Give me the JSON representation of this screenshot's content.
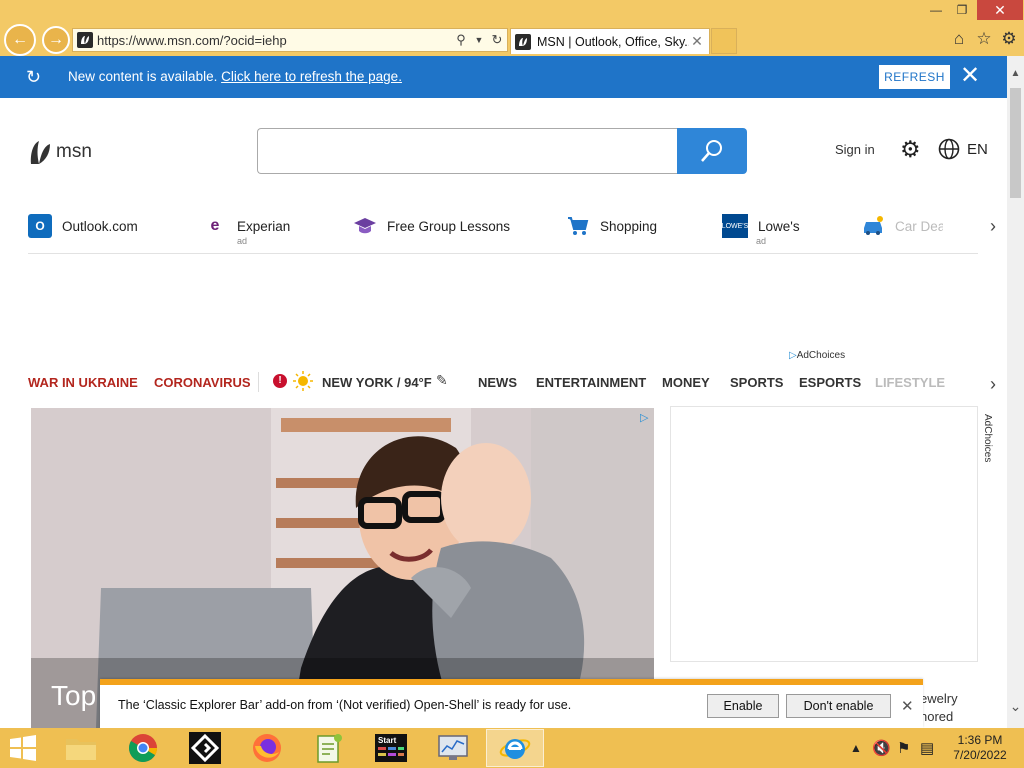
{
  "browser": {
    "url": "https://www.msn.com/?ocid=iehp",
    "tab_title": "MSN | Outlook, Office, Sky...",
    "window_controls": {
      "minimize": "—",
      "maximize": "❐",
      "close": "✕"
    }
  },
  "notification": {
    "message": "New content is available. ",
    "link_text": "Click here to refresh the page.",
    "refresh_label": "REFRESH"
  },
  "header": {
    "logo_text": "msn",
    "sign_in": "Sign in",
    "language": "EN"
  },
  "quicklinks": [
    {
      "label": "Outlook.com",
      "ad": "",
      "icon": "outlook-icon",
      "color": "#0f6cbd"
    },
    {
      "label": "Experian",
      "ad": "ad",
      "icon": "experian-icon",
      "color": "#6d2077"
    },
    {
      "label": "Free Group Lessons",
      "ad": "",
      "icon": "graduation-cap-icon",
      "color": "#6b3fa0"
    },
    {
      "label": "Shopping",
      "ad": "",
      "icon": "shopping-cart-icon",
      "color": "#1f74c8"
    },
    {
      "label": "Lowe's",
      "ad": "ad",
      "icon": "lowes-icon",
      "color": "#004990"
    },
    {
      "label": "Car Deals",
      "ad": "",
      "icon": "car-icon",
      "color": "#2f86d8"
    }
  ],
  "adchoices": "AdChoices",
  "topnav": {
    "war": "WAR IN UKRAINE",
    "corona": "CORONAVIRUS",
    "weather": "NEW YORK / 94°F",
    "news": "NEWS",
    "entertainment": "ENTERTAINMENT",
    "money": "MONEY",
    "sports": "SPORTS",
    "esports": "ESPORTS",
    "lifestyle": "LIFESTYLE"
  },
  "hero": {
    "title": "Top"
  },
  "card_peek": {
    "line1": "ewelry",
    "line2": "nored"
  },
  "addon_bar": {
    "message": "The ‘Classic Explorer Bar’ add-on from ‘(Not verified) Open-Shell’ is ready for use.",
    "enable": "Enable",
    "dont_enable": "Don't enable"
  },
  "taskbar": {
    "apps": [
      "file-explorer",
      "chrome",
      "app-g",
      "firefox",
      "notepad-plus",
      "start-menu-app",
      "system-monitor",
      "internet-explorer"
    ],
    "start_app_label": "Start",
    "time": "1:36 PM",
    "date": "7/20/2022"
  },
  "colors": {
    "ie_frame": "#f3c966",
    "notify_bar": "#1f74c8",
    "search_button": "#2f86d8",
    "news_red": "#b3261e",
    "addon_accent": "#f3a21b"
  }
}
